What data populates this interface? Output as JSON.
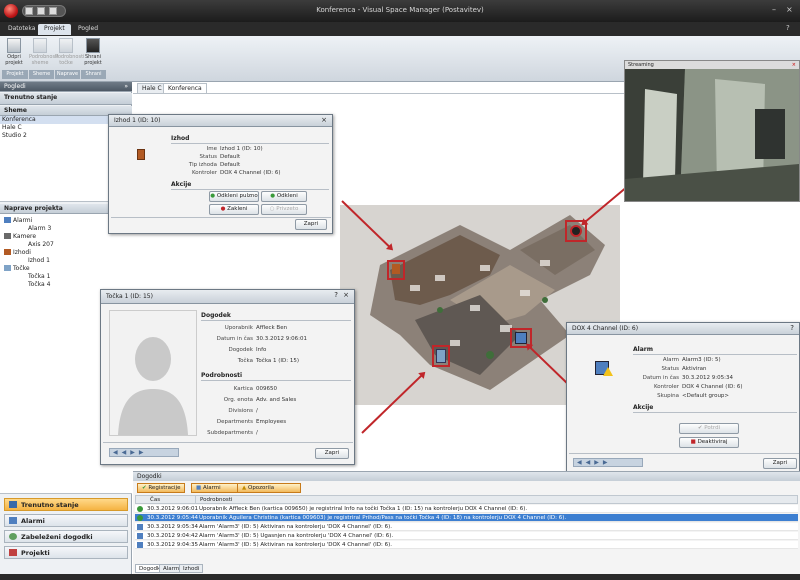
{
  "window": {
    "title": "Konferenca - Visual Space Manager (Postavitev)",
    "min": "–",
    "close": "×",
    "help": "?"
  },
  "ribbon_tabs": [
    "Datoteka",
    "Projekt",
    "Pogled"
  ],
  "ribbon": {
    "buttons": [
      "Odpri projekt",
      "Podrobnosti sheme",
      "Podrobnosti točke",
      "Shrani projekt"
    ],
    "groups": [
      "Projekt",
      "Sheme",
      "Naprave",
      "Shrani"
    ]
  },
  "left": {
    "panel_title": "Pogledi",
    "pin": "»",
    "current_state": "Trenutno stanje",
    "schemes_title": "Sheme",
    "schemes": [
      "Konferenca",
      "Hale C",
      "Studio 2"
    ],
    "devices_title": "Naprave projekta",
    "tree": [
      {
        "label": "Alarmi",
        "level": 0,
        "icon": "alarm"
      },
      {
        "label": "Alarm 3",
        "level": 1,
        "icon": "none"
      },
      {
        "label": "Kamere",
        "level": 0,
        "icon": "camera"
      },
      {
        "label": "Axis 207",
        "level": 1,
        "icon": "none"
      },
      {
        "label": "Izhodi",
        "level": 0,
        "icon": "output"
      },
      {
        "label": "Izhod 1",
        "level": 1,
        "icon": "none"
      },
      {
        "label": "Točke",
        "level": 0,
        "icon": "point"
      },
      {
        "label": "Točka 1",
        "level": 1,
        "icon": "none"
      },
      {
        "label": "Točka 4",
        "level": 1,
        "icon": "none"
      }
    ],
    "nav": [
      "Trenutno stanje",
      "Alarmi",
      "Zabeleženi dogodki",
      "Projekti"
    ]
  },
  "doc_tabs": [
    "Hale C",
    "Konferenca"
  ],
  "camera_window": {
    "title": "Streaming",
    "close": "×"
  },
  "dlg_izhod": {
    "title": "Izhod 1 (ID: 10)",
    "close": "×",
    "section1": "Izhod",
    "fields": [
      {
        "k": "Ime",
        "v": "Izhod 1 (ID: 10)"
      },
      {
        "k": "Status",
        "v": "Default"
      },
      {
        "k": "Tip izhoda",
        "v": "Default"
      },
      {
        "k": "Kontroler",
        "v": "DOX 4 Channel (ID: 6)"
      }
    ],
    "section2": "Akcije",
    "buttons": [
      "Odkleni pulzno",
      "Odkleni",
      "Zakleni",
      "Privzeto"
    ],
    "ok": "Zapri"
  },
  "dlg_tocka": {
    "title": "Točka 1 (ID: 15)",
    "help": "?",
    "close": "×",
    "section1": "Dogodek",
    "fields1": [
      {
        "k": "Uporabnik",
        "v": "Affleck Ben"
      },
      {
        "k": "Datum in čas",
        "v": "30.3.2012 9:06:01"
      },
      {
        "k": "Dogodek",
        "v": "Info"
      },
      {
        "k": "Točka",
        "v": "Točka 1 (ID: 15)"
      }
    ],
    "section2": "Podrobnosti",
    "fields2": [
      {
        "k": "Kartica",
        "v": "009650"
      },
      {
        "k": "Org. enota",
        "v": "Adv. and Sales"
      },
      {
        "k": "Divisions",
        "v": "/"
      },
      {
        "k": "Departments",
        "v": "Employees"
      },
      {
        "k": "Subdepartments",
        "v": "/"
      }
    ],
    "ok": "Zapri"
  },
  "dlg_dox": {
    "title": "DOX 4 Channel (ID: 6)",
    "help": "?",
    "section1": "Alarm",
    "fields": [
      {
        "k": "Alarm",
        "v": "Alarm3 (ID: 5)"
      },
      {
        "k": "Status",
        "v": "Aktiviran"
      },
      {
        "k": "Datum in čas",
        "v": "30.3.2012 9:05:34"
      },
      {
        "k": "Kontroler",
        "v": "DOX 4 Channel (ID: 6)"
      },
      {
        "k": "Skupina",
        "v": "<Default group>"
      }
    ],
    "section2": "Akcije",
    "buttons": [
      "Potrdi",
      "Deaktiviraj"
    ],
    "ok": "Zapri"
  },
  "events": {
    "title": "Dogodki",
    "filters": [
      "Registracije",
      "Alarmi",
      "Opozorila"
    ],
    "columns": [
      "Čas",
      "Podrobnosti"
    ],
    "rows": [
      {
        "time": "30.3.2012 9:06:01",
        "text": "Uporabnik Affleck Ben (kartica 009650) je registriral Info na točki Točka 1 (ID: 15) na kontrolerju DOX 4 Channel (ID: 6).",
        "icon": "ok",
        "selected": false
      },
      {
        "time": "30.3.2012 9:05:44",
        "text": "Uporabnik Aguilera Christina (kartica 009603) je registriral Prihod/Pass na točki Točka 4 (ID: 18) na kontrolerju DOX 4 Channel (ID: 6).",
        "icon": "ok",
        "selected": true
      },
      {
        "time": "30.3.2012 9:05:34",
        "text": "Alarm 'Alarm3' (ID: 5) Aktiviran na kontrolerju 'DOX 4 Channel' (ID: 6).",
        "icon": "alarm",
        "selected": false
      },
      {
        "time": "30.3.2012 9:04:42",
        "text": "Alarm 'Alarm3' (ID: 5) Ugasnjen na kontrolerju 'DOX 4 Channel' (ID: 6).",
        "icon": "alarm",
        "selected": false
      },
      {
        "time": "30.3.2012 9:04:35",
        "text": "Alarm 'Alarm3' (ID: 5) Aktiviran na kontrolerju 'DOX 4 Channel' (ID: 6).",
        "icon": "alarm",
        "selected": false
      }
    ],
    "bottom_tabs": [
      "Dogodki",
      "Alarmi",
      "Izhodi"
    ]
  },
  "colors": {
    "accent": "#f5b342",
    "selected_row": "#3d7fd1",
    "annotation": "#c0262a"
  }
}
